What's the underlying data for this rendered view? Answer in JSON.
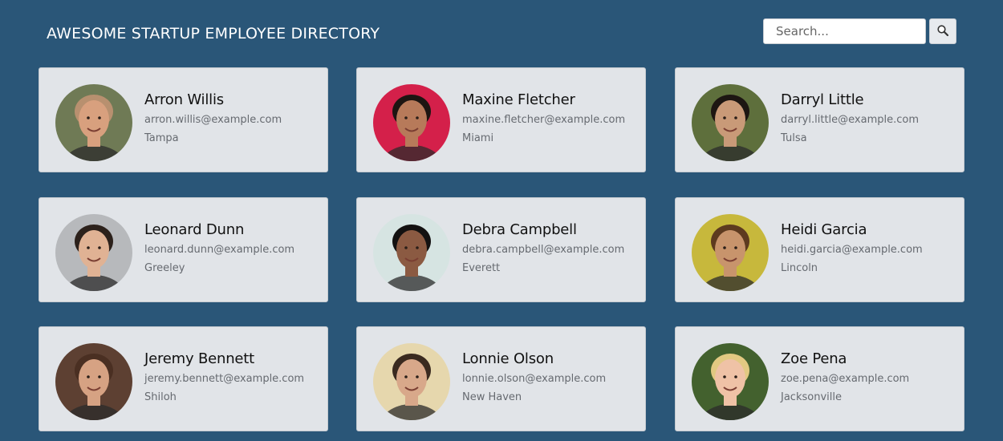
{
  "header": {
    "title": "AWESOME STARTUP EMPLOYEE DIRECTORY",
    "search_placeholder": "Search...",
    "search_value": "",
    "search_icon": "magnifier-icon"
  },
  "colors": {
    "background": "#2a5678",
    "card": "#e1e4e8",
    "title": "#ffffff",
    "secondary_text": "#666a70"
  },
  "employees": [
    {
      "name": "Arron Willis",
      "email": "arron.willis@example.com",
      "city": "Tampa",
      "avatar_bg": "#6f7a55",
      "skin": "#d8a07e",
      "hair": "#b8906f"
    },
    {
      "name": "Maxine Fletcher",
      "email": "maxine.fletcher@example.com",
      "city": "Miami",
      "avatar_bg": "#d4204a",
      "skin": "#b77a5a",
      "hair": "#1d1512"
    },
    {
      "name": "Darryl Little",
      "email": "darryl.little@example.com",
      "city": "Tulsa",
      "avatar_bg": "#5e6f3c",
      "skin": "#c99a78",
      "hair": "#1d1612"
    },
    {
      "name": "Leonard Dunn",
      "email": "leonard.dunn@example.com",
      "city": "Greeley",
      "avatar_bg": "#b7b9bc",
      "skin": "#e0b294",
      "hair": "#2c211b"
    },
    {
      "name": "Debra Campbell",
      "email": "debra.campbell@example.com",
      "city": "Everett",
      "avatar_bg": "#d6e4e2",
      "skin": "#8b5a42",
      "hair": "#131111"
    },
    {
      "name": "Heidi Garcia",
      "email": "heidi.garcia@example.com",
      "city": "Lincoln",
      "avatar_bg": "#c7b83c",
      "skin": "#c8946c",
      "hair": "#5d3a1f"
    },
    {
      "name": "Jeremy Bennett",
      "email": "jeremy.bennett@example.com",
      "city": "Shiloh",
      "avatar_bg": "#5d4032",
      "skin": "#d6a283",
      "hair": "#4a2f22"
    },
    {
      "name": "Lonnie Olson",
      "email": "lonnie.olson@example.com",
      "city": "New Haven",
      "avatar_bg": "#e6d7ad",
      "skin": "#d8a88a",
      "hair": "#3a2a20"
    },
    {
      "name": "Zoe Pena",
      "email": "zoe.pena@example.com",
      "city": "Jacksonville",
      "avatar_bg": "#43612e",
      "skin": "#efc2a6",
      "hair": "#e2c982"
    }
  ]
}
